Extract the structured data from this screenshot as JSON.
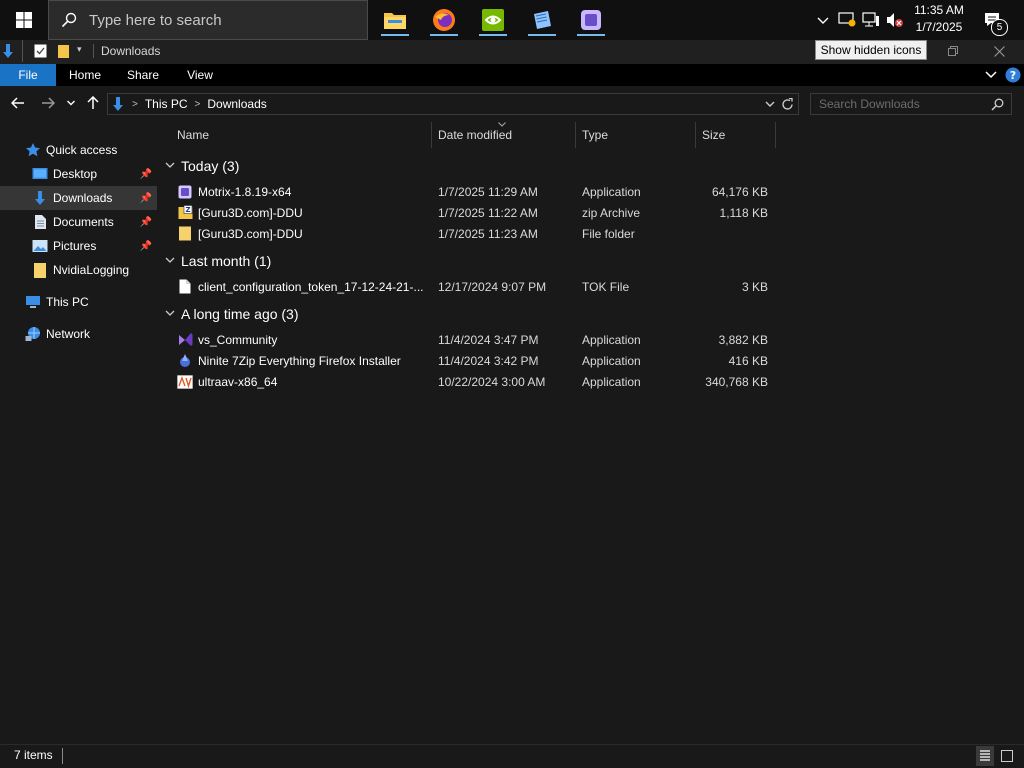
{
  "taskbar": {
    "search_placeholder": "Type here to search",
    "clock_time": "11:35 AM",
    "clock_date": "1/7/2025",
    "notification_count": "5",
    "tooltip": "Show hidden icons"
  },
  "window": {
    "title": "Downloads"
  },
  "ribbon": {
    "tabs": [
      {
        "label": "File"
      },
      {
        "label": "Home"
      },
      {
        "label": "Share"
      },
      {
        "label": "View"
      }
    ]
  },
  "address": {
    "crumbs": [
      "This PC",
      "Downloads"
    ],
    "search_placeholder": "Search Downloads"
  },
  "nav": {
    "quick_access": "Quick access",
    "items": [
      {
        "label": "Desktop"
      },
      {
        "label": "Downloads"
      },
      {
        "label": "Documents"
      },
      {
        "label": "Pictures"
      },
      {
        "label": "NvidiaLogging"
      }
    ],
    "this_pc": "This PC",
    "network": "Network"
  },
  "columns": {
    "name": "Name",
    "date": "Date modified",
    "type": "Type",
    "size": "Size"
  },
  "groups": [
    {
      "label": "Today (3)",
      "rows": [
        {
          "name": "Motrix-1.8.19-x64",
          "date": "1/7/2025 11:29 AM",
          "type": "Application",
          "size": "64,176 KB"
        },
        {
          "name": "[Guru3D.com]-DDU",
          "date": "1/7/2025 11:22 AM",
          "type": "zip Archive",
          "size": "1,118 KB"
        },
        {
          "name": "[Guru3D.com]-DDU",
          "date": "1/7/2025 11:23 AM",
          "type": "File folder",
          "size": ""
        }
      ]
    },
    {
      "label": "Last month (1)",
      "rows": [
        {
          "name": "client_configuration_token_17-12-24-21-...",
          "date": "12/17/2024 9:07 PM",
          "type": "TOK File",
          "size": "3 KB"
        }
      ]
    },
    {
      "label": "A long time ago (3)",
      "rows": [
        {
          "name": "vs_Community",
          "date": "11/4/2024 3:47 PM",
          "type": "Application",
          "size": "3,882 KB"
        },
        {
          "name": "Ninite 7Zip Everything Firefox Installer",
          "date": "11/4/2024 3:42 PM",
          "type": "Application",
          "size": "416 KB"
        },
        {
          "name": "ultraav-x86_64",
          "date": "10/22/2024 3:00 AM",
          "type": "Application",
          "size": "340,768 KB"
        }
      ]
    }
  ],
  "status": {
    "items_count": "7 items"
  }
}
